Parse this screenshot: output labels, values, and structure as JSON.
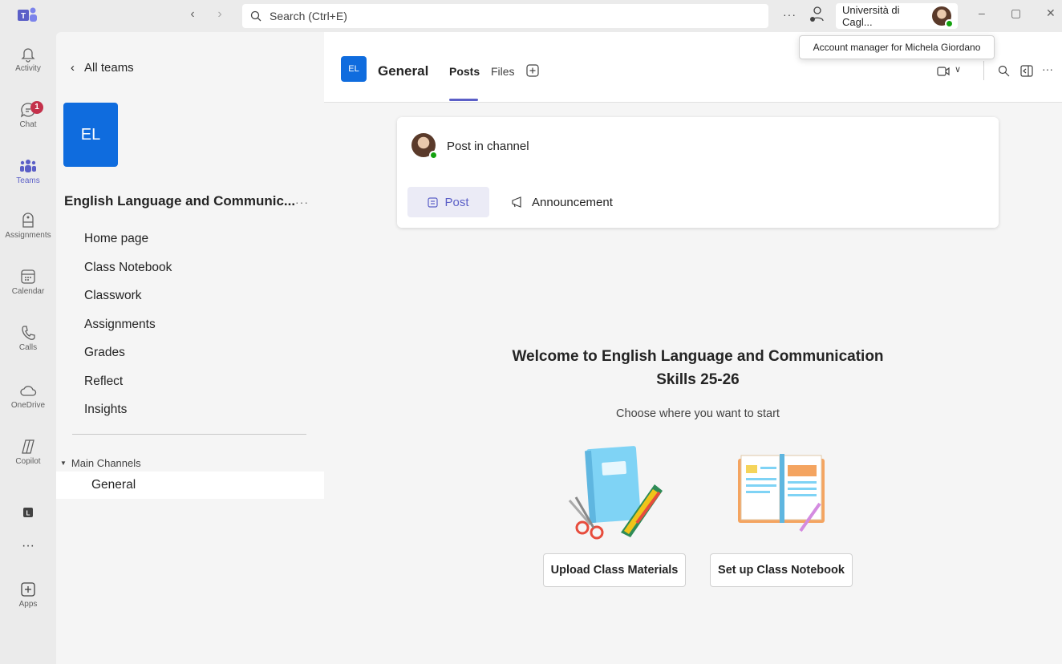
{
  "titlebar": {
    "search_placeholder": "Search (Ctrl+E)",
    "org_name": "Università di Cagl...",
    "tooltip": "Account manager for Michela Giordano"
  },
  "rail": {
    "items": [
      {
        "label": "Activity",
        "icon": "bell-icon"
      },
      {
        "label": "Chat",
        "icon": "chat-icon",
        "badge": "1"
      },
      {
        "label": "Teams",
        "icon": "teams-icon"
      },
      {
        "label": "Assignments",
        "icon": "assignments-icon"
      },
      {
        "label": "Calendar",
        "icon": "calendar-icon"
      },
      {
        "label": "Calls",
        "icon": "phone-icon"
      },
      {
        "label": "OneDrive",
        "icon": "cloud-icon"
      },
      {
        "label": "Copilot",
        "icon": "copilot-icon"
      },
      {
        "label": "",
        "icon": "app-l-icon"
      },
      {
        "label": "",
        "icon": "more-icon"
      },
      {
        "label": "Apps",
        "icon": "add-apps-icon"
      }
    ],
    "active": "Teams"
  },
  "leftpane": {
    "back_label": "All teams",
    "team_initials": "EL",
    "team_name": "English Language and Communic...",
    "nav": [
      "Home page",
      "Class Notebook",
      "Classwork",
      "Assignments",
      "Grades",
      "Reflect",
      "Insights"
    ],
    "channels_header": "Main Channels",
    "channels": [
      "General"
    ]
  },
  "main": {
    "channel_initials": "EL",
    "channel_name": "General",
    "tabs": [
      "Posts",
      "Files"
    ],
    "active_tab": "Posts",
    "compose_placeholder": "Post in channel",
    "post_label": "Post",
    "announcement_label": "Announcement",
    "welcome_line1": "Welcome to English Language and Communication",
    "welcome_line2": "Skills 25-26",
    "welcome_sub": "Choose where you want to start",
    "upload_label": "Upload Class Materials",
    "notebook_label": "Set up Class Notebook"
  },
  "colors": {
    "accent": "#5b5fc7",
    "team_tile": "#0f6cde",
    "badge": "#c4314b",
    "presence": "#13a10e"
  }
}
